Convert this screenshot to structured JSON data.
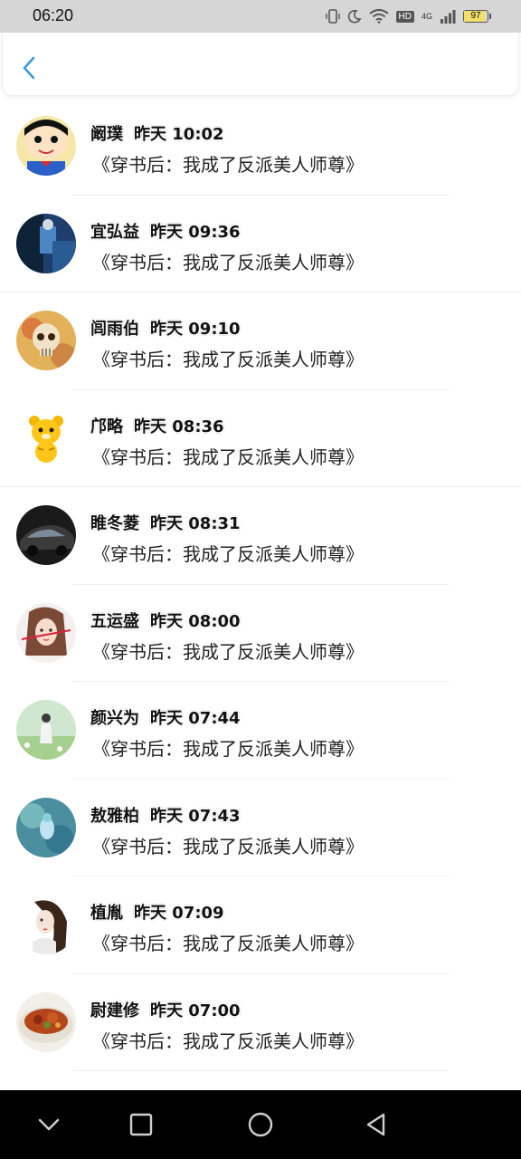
{
  "status_bar": {
    "time": "06:20",
    "hd": "HD",
    "network": "4G",
    "battery": "97",
    "icons": [
      "vibrate-icon",
      "moon-icon",
      "wifi-icon",
      "hd-icon",
      "signal-icon",
      "battery-icon"
    ]
  },
  "header": {
    "back_icon": "chevron-left-icon",
    "accent_color": "#3a9ad9"
  },
  "list": [
    {
      "name": "阚璞",
      "time": "昨天 10:02",
      "message": "《穿书后：我成了反派美人师尊》"
    },
    {
      "name": "宜弘益",
      "time": "昨天 09:36",
      "message": "《穿书后：我成了反派美人师尊》"
    },
    {
      "name": "闾雨伯",
      "time": "昨天 09:10",
      "message": "《穿书后：我成了反派美人师尊》"
    },
    {
      "name": "邝略",
      "time": "昨天 08:36",
      "message": "《穿书后：我成了反派美人师尊》"
    },
    {
      "name": "睢冬菱",
      "time": "昨天 08:31",
      "message": "《穿书后：我成了反派美人师尊》"
    },
    {
      "name": "五运盛",
      "time": "昨天 08:00",
      "message": "《穿书后：我成了反派美人师尊》"
    },
    {
      "name": "颜兴为",
      "time": "昨天 07:44",
      "message": "《穿书后：我成了反派美人师尊》"
    },
    {
      "name": "敖雅柏",
      "time": "昨天 07:43",
      "message": "《穿书后：我成了反派美人师尊》"
    },
    {
      "name": "植胤",
      "time": "昨天 07:09",
      "message": "《穿书后：我成了反派美人师尊》"
    },
    {
      "name": "尉建修",
      "time": "昨天 07:00",
      "message": "《穿书后：我成了反派美人师尊》"
    }
  ],
  "navbar": {
    "icons": [
      "collapse-chevron-icon",
      "recents-square-icon",
      "home-circle-icon",
      "back-triangle-icon"
    ]
  }
}
